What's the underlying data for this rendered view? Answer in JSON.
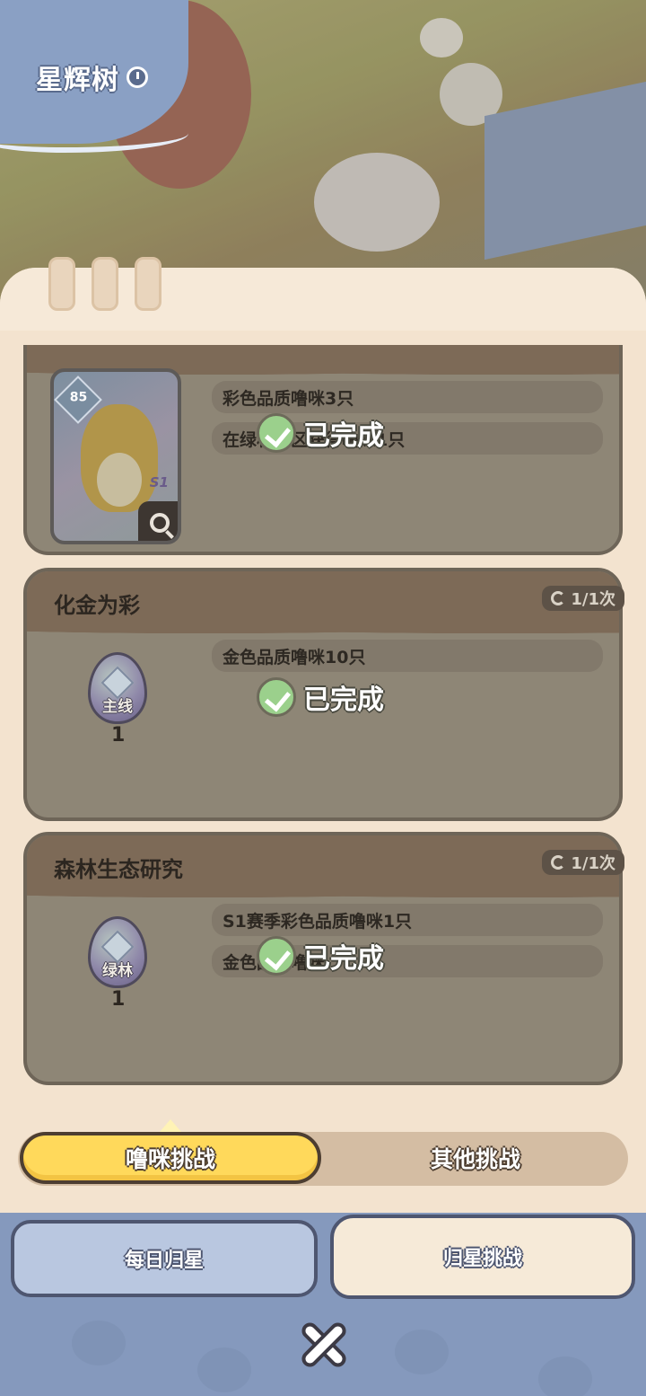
{
  "header": {
    "title": "星辉树"
  },
  "cards": [
    {
      "title": "",
      "requirements": [
        "彩色品质噜咪3只",
        "在绿林地区获得噜咪1只"
      ],
      "status": "已完成",
      "reward": {
        "type": "character",
        "level": "85",
        "season": "S1"
      }
    },
    {
      "title": "化金为彩",
      "count": "1/1次",
      "requirements": [
        "金色品质噜咪10只"
      ],
      "status": "已完成",
      "reward": {
        "type": "egg",
        "label": "主线",
        "count": "1"
      }
    },
    {
      "title": "森林生态研究",
      "count": "1/1次",
      "requirements": [
        "S1赛季彩色品质噜咪1只",
        "金色品质噜咪"
      ],
      "status": "已完成",
      "reward": {
        "type": "egg",
        "label": "绿林",
        "count": "1"
      }
    }
  ],
  "segment": {
    "active": "噜咪挑战",
    "inactive": "其他挑战"
  },
  "bottom_tabs": {
    "left": "每日归星",
    "right": "归星挑战"
  },
  "colors": {
    "accent_yellow": "#ffd95b",
    "bottom_blue": "#8599bd",
    "panel_bg": "#f3e3cf"
  }
}
